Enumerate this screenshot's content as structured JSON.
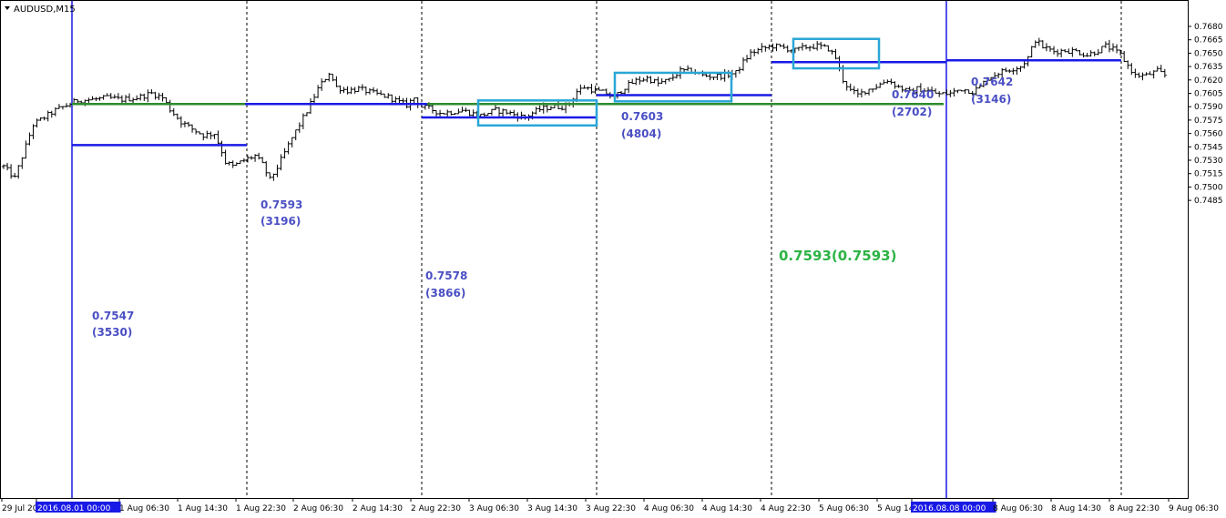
{
  "chart_data": {
    "type": "bar",
    "title": "AUDUSD,M15",
    "symbol_label": "AUDUSD,M15",
    "ylim": [
      0.748,
      0.769
    ],
    "y_ticks": [
      "0.7680",
      "0.7665",
      "0.7650",
      "0.7635",
      "0.7620",
      "0.7605",
      "0.7590",
      "0.7575",
      "0.7560",
      "0.7545",
      "0.7530",
      "0.7515",
      "0.7500",
      "0.7485"
    ],
    "x_ticks": [
      "29 Jul 20",
      "2016.08.01 00:00",
      "1 Aug 06:30",
      "1 Aug 14:30",
      "1 Aug 22:30",
      "2 Aug 06:30",
      "2 Aug 14:30",
      "2 Aug 22:30",
      "3 Aug 06:30",
      "3 Aug 14:30",
      "3 Aug 22:30",
      "4 Aug 06:30",
      "4 Aug 14:30",
      "4 Aug 22:30",
      "5 Aug 06:30",
      "5 Aug 14",
      "2016.08.08 00:00",
      "8 Aug 06:30",
      "8 Aug 14:30",
      "8 Aug 22:30",
      "9 Aug 06:30"
    ],
    "highlighted_x_ticks": [
      "2016.08.01 00:00",
      "2016.08.08 00:00"
    ],
    "price_path": [
      [
        0,
        0.7523
      ],
      [
        3,
        0.751
      ],
      [
        8,
        0.757
      ],
      [
        14,
        0.7586
      ],
      [
        20,
        0.7597
      ],
      [
        24,
        0.7598
      ],
      [
        28,
        0.76
      ],
      [
        32,
        0.7598
      ],
      [
        36,
        0.76
      ],
      [
        40,
        0.7605
      ],
      [
        43,
        0.76
      ],
      [
        45,
        0.7587
      ],
      [
        48,
        0.7573
      ],
      [
        51,
        0.7565
      ],
      [
        54,
        0.7558
      ],
      [
        57,
        0.756
      ],
      [
        59,
        0.754
      ],
      [
        60,
        0.7528
      ],
      [
        62,
        0.7523
      ],
      [
        65,
        0.753
      ],
      [
        68,
        0.7535
      ],
      [
        70,
        0.7525
      ],
      [
        72,
        0.7508
      ],
      [
        74,
        0.7522
      ],
      [
        78,
        0.7555
      ],
      [
        82,
        0.7585
      ],
      [
        85,
        0.761
      ],
      [
        88,
        0.7628
      ],
      [
        90,
        0.7612
      ],
      [
        93,
        0.7608
      ],
      [
        96,
        0.761
      ],
      [
        100,
        0.7605
      ],
      [
        104,
        0.7601
      ],
      [
        107,
        0.7595
      ],
      [
        109,
        0.7592
      ],
      [
        111,
        0.76
      ],
      [
        113,
        0.759
      ],
      [
        115,
        0.7588
      ],
      [
        118,
        0.7583
      ],
      [
        121,
        0.7584
      ],
      [
        124,
        0.7586
      ],
      [
        127,
        0.7582
      ],
      [
        129,
        0.758
      ],
      [
        131,
        0.7583
      ],
      [
        133,
        0.7586
      ],
      [
        136,
        0.7584
      ],
      [
        139,
        0.758
      ],
      [
        141,
        0.7578
      ],
      [
        143,
        0.7583
      ],
      [
        145,
        0.7587
      ],
      [
        148,
        0.759
      ],
      [
        151,
        0.759
      ],
      [
        153,
        0.7593
      ],
      [
        155,
        0.7607
      ],
      [
        157,
        0.7612
      ],
      [
        160,
        0.7608
      ],
      [
        163,
        0.7605
      ],
      [
        165,
        0.76
      ],
      [
        168,
        0.7612
      ],
      [
        171,
        0.7619
      ],
      [
        174,
        0.7622
      ],
      [
        177,
        0.7616
      ],
      [
        180,
        0.762
      ],
      [
        183,
        0.763
      ],
      [
        186,
        0.763
      ],
      [
        189,
        0.7625
      ],
      [
        192,
        0.7624
      ],
      [
        195,
        0.7625
      ],
      [
        198,
        0.7628
      ],
      [
        200,
        0.764
      ],
      [
        202,
        0.765
      ],
      [
        205,
        0.7655
      ],
      [
        208,
        0.7658
      ],
      [
        211,
        0.7656
      ],
      [
        214,
        0.7653
      ],
      [
        217,
        0.7657
      ],
      [
        220,
        0.7658
      ],
      [
        223,
        0.7655
      ],
      [
        225,
        0.7645
      ],
      [
        227,
        0.762
      ],
      [
        229,
        0.7608
      ],
      [
        231,
        0.7603
      ],
      [
        233,
        0.7608
      ],
      [
        236,
        0.7613
      ],
      [
        239,
        0.762
      ],
      [
        242,
        0.7612
      ],
      [
        245,
        0.7606
      ],
      [
        247,
        0.761
      ],
      [
        250,
        0.7608
      ],
      [
        253,
        0.7604
      ],
      [
        256,
        0.7605
      ],
      [
        259,
        0.761
      ],
      [
        262,
        0.7607
      ],
      [
        264,
        0.7612
      ],
      [
        266,
        0.7622
      ],
      [
        269,
        0.7628
      ],
      [
        272,
        0.7632
      ],
      [
        275,
        0.7635
      ],
      [
        277,
        0.7645
      ],
      [
        279,
        0.7665
      ],
      [
        281,
        0.7657
      ],
      [
        284,
        0.7652
      ],
      [
        287,
        0.7653
      ],
      [
        290,
        0.7652
      ],
      [
        293,
        0.7648
      ],
      [
        296,
        0.7653
      ],
      [
        298,
        0.7658
      ],
      [
        300,
        0.7654
      ],
      [
        302,
        0.7648
      ],
      [
        304,
        0.7636
      ],
      [
        306,
        0.7625
      ],
      [
        309,
        0.7625
      ],
      [
        312,
        0.763
      ],
      [
        314,
        0.7625
      ]
    ],
    "levels": [
      {
        "price": 0.7547,
        "label": "0.7547",
        "volume": "(3530)",
        "color": "#1a1ae6"
      },
      {
        "price": 0.7593,
        "label": "0.7593",
        "volume": "(3196)",
        "color": "#1a1ae6"
      },
      {
        "price": 0.7578,
        "label": "0.7578",
        "volume": "(3866)",
        "color": "#1a1ae6"
      },
      {
        "price": 0.7603,
        "label": "0.7603",
        "volume": "(4804)",
        "color": "#1a1ae6"
      },
      {
        "price": 0.764,
        "label": "0.7640",
        "volume": "(2702)",
        "color": "#1a1ae6"
      },
      {
        "price": 0.7642,
        "label": "0.7642",
        "volume": "(3146)",
        "color": "#1a1ae6"
      }
    ],
    "weekly_level": {
      "price": 0.7593,
      "label": "0.7593(0.7593)",
      "color": "#2e8b2e",
      "label_color": "#2db344"
    },
    "consolidation_boxes": [
      {
        "price_high": 0.7597,
        "price_low": 0.7569,
        "color": "#2aa6d6"
      },
      {
        "price_high": 0.7628,
        "price_low": 0.7596,
        "color": "#2aa6d6"
      },
      {
        "price_high": 0.7666,
        "price_low": 0.7633,
        "color": "#2aa6d6"
      }
    ],
    "week_separator_color": "#1a1ae6",
    "grid": "vertical dashed session separators"
  }
}
